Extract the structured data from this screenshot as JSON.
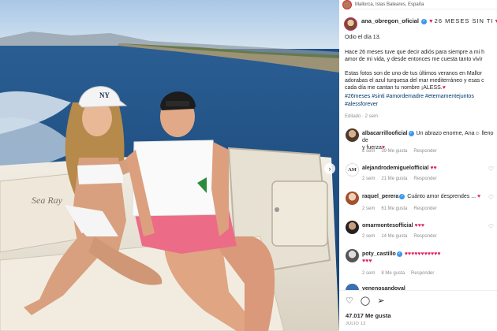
{
  "post": {
    "location": "Mallorca, Islas Baleares, España",
    "author": "ana_obregon_oficial",
    "caption_title": "26 MESES SIN TI",
    "caption_lines": [
      "Odio el día 13.",
      "",
      "Hace 26 meses tuve que decir adiós para siempre a mi h",
      "amor de mi vida, y desde entonces me cuesta tanto vivir",
      "",
      "Estas fotos son de uno de tus últimos veranos en Mallor",
      "adorabas el azul turquesa del mar mediterráneo y esas c",
      "cada día me cantan tu nombre ¡ALESS."
    ],
    "hashtags_line1": "#26meses #sinti #amordemadre #eternamentejuntos",
    "hashtags_line2": "#alessforever",
    "edited": "Editado · 2 sem",
    "boat_brand": "Sea Ray",
    "cap_logo": "NY"
  },
  "comments": [
    {
      "user": "albacarrillooficial",
      "verified": true,
      "text": "Un abrazo enorme, Ana☺ lleno de",
      "text2": "y fuerza",
      "age": "2 sem",
      "likes": "39 Me gusta",
      "reply": "Responder"
    },
    {
      "user": "alejandrodemiguelofficial",
      "verified": false,
      "text": "",
      "age": "2 sem",
      "likes": "21 Me gusta",
      "reply": "Responder"
    },
    {
      "user": "raquel_perera",
      "verified": true,
      "text": "Cuánto amor desprendes ...",
      "age": "2 sem",
      "likes": "61 Me gusta",
      "reply": "Responder"
    },
    {
      "user": "omarmontesofficial",
      "verified": false,
      "text": "",
      "age": "2 sem",
      "likes": "14 Me gusta",
      "reply": "Responder"
    },
    {
      "user": "poty_castillo",
      "verified": true,
      "text": "",
      "age": "2 sem",
      "likes": "8 Me gusta",
      "reply": "Responder"
    },
    {
      "user": "venenosandoval",
      "verified": false,
      "text": ""
    }
  ],
  "actions": {
    "likes": "47.017 Me gusta",
    "date": "JULIO 13"
  },
  "colors": {
    "sea": "#1f4f86",
    "sky": "#b9d3ea",
    "heart": "#e0245e",
    "link": "#00376b",
    "verified": "#3897f0"
  }
}
